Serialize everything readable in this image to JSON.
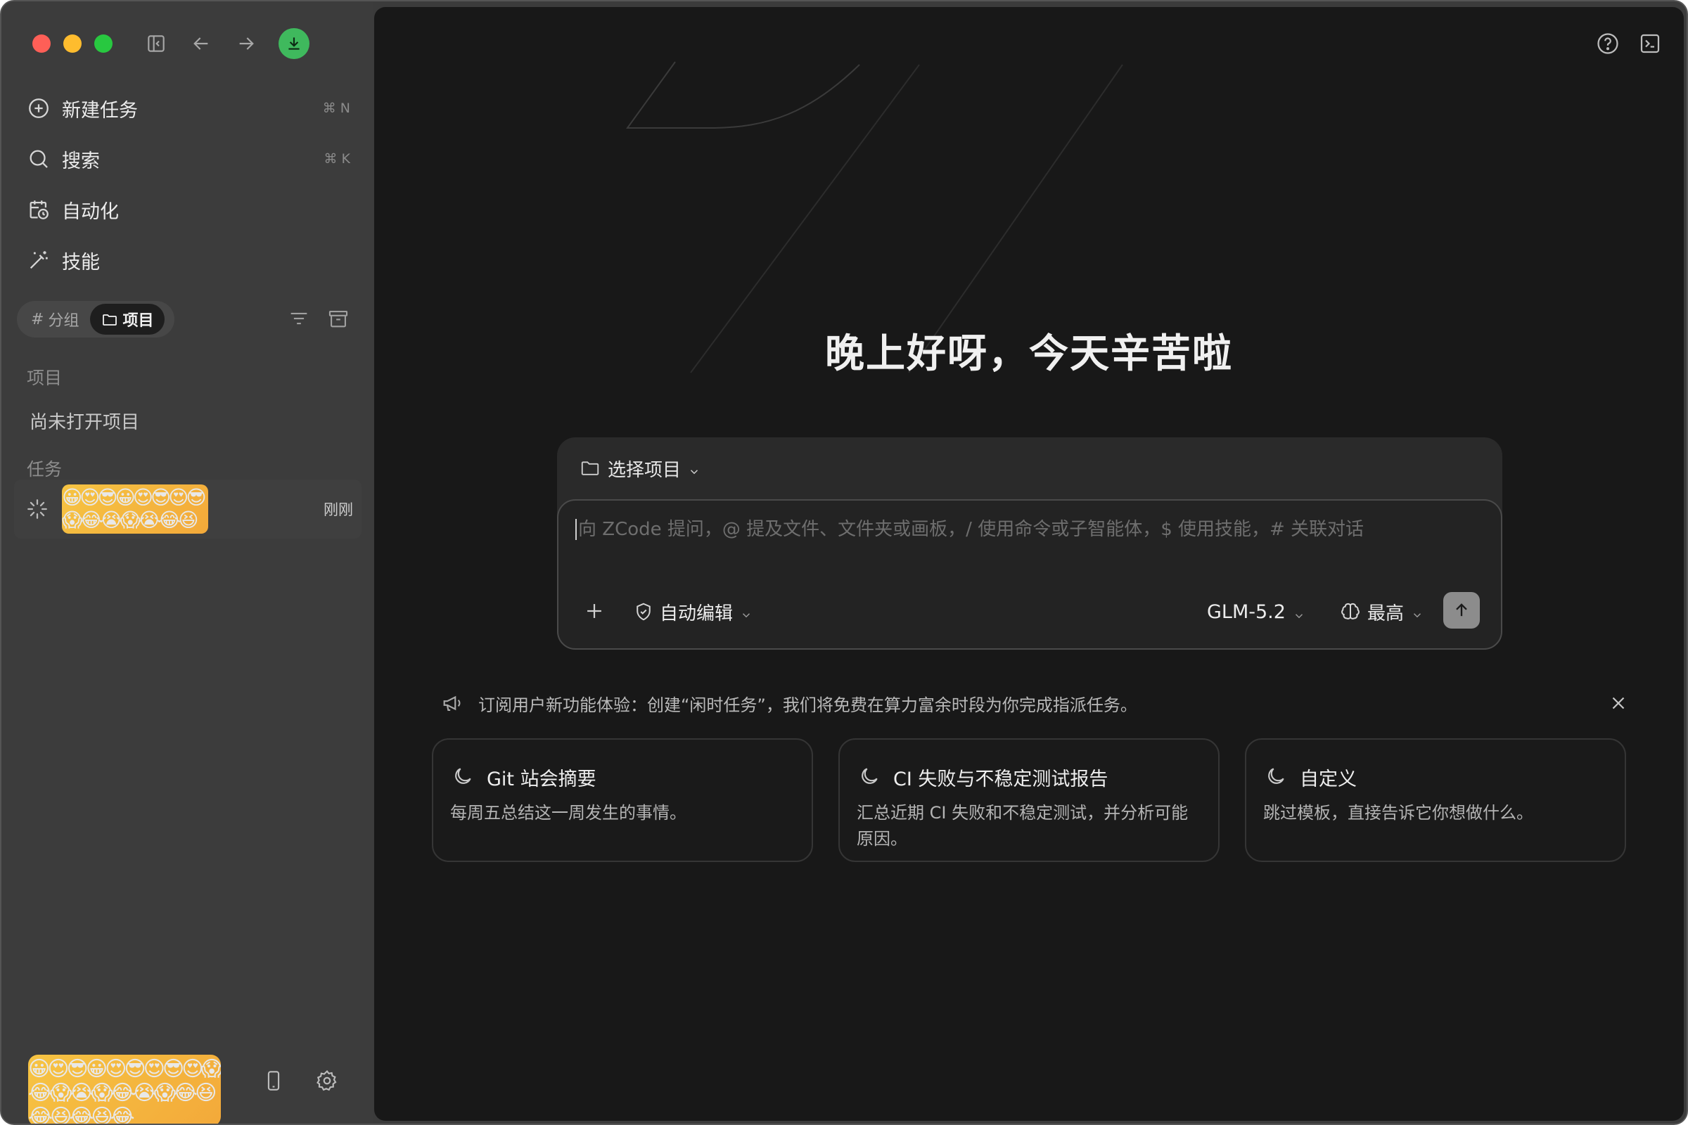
{
  "sidebar": {
    "shortcuts": {
      "new_task": "⌘ N",
      "search": "⌘ K"
    },
    "nav": {
      "new_task": "新建任务",
      "search": "搜索",
      "automation": "自动化",
      "skills": "技能"
    },
    "segments": {
      "groups": "分组",
      "projects": "项目",
      "groups_prefix": "#"
    },
    "sections": {
      "projects": "项目",
      "tasks": "任务"
    },
    "empty_projects": "尚未打开项目",
    "task": {
      "thumbnail_emojis": "😀😍😎😀😍😎😍😎😱😂😭😱😭😂😆",
      "time": "刚刚"
    },
    "avatar_emojis": "😀😍😎😀😍😎😍😎😍😱😂😱😭😱😂😭😱😂😆😂😆😂😆😂"
  },
  "main": {
    "greeting": "晚上好呀，今天辛苦啦",
    "composer": {
      "project_picker": "选择项目",
      "placeholder": "向 ZCode 提问，@ 提及文件、文件夹或画板，/ 使用命令或子智能体，$ 使用技能，# 关联对话",
      "mode": "自动编辑",
      "model": "GLM-5.2",
      "effort": "最高"
    },
    "notice": "订阅用户新功能体验：创建“闲时任务”，我们将免费在算力富余时段为你完成指派任务。",
    "cards": [
      {
        "title": "Git 站会摘要",
        "desc": "每周五总结这一周发生的事情。"
      },
      {
        "title": "CI 失败与不稳定测试报告",
        "desc": "汇总近期 CI 失败和不稳定测试，并分析可能原因。"
      },
      {
        "title": "自定义",
        "desc": "跳过模板，直接告诉它你想做什么。"
      }
    ]
  },
  "colors": {
    "sidebar_bg": "#3c3c3c",
    "main_bg": "#181818",
    "download_accent": "#3fb95d",
    "traffic_red": "#fe5f57",
    "traffic_yellow": "#febc2e",
    "traffic_green": "#28c840"
  },
  "icons": [
    "sidebar-toggle-icon",
    "back-arrow-icon",
    "forward-arrow-icon",
    "download-icon",
    "plus-circle-icon",
    "search-icon",
    "calendar-clock-icon",
    "magic-wand-icon",
    "hash-icon",
    "folder-icon",
    "filter-icon",
    "archive-icon",
    "spinner-icon",
    "phone-icon",
    "gear-icon",
    "help-icon",
    "terminal-icon",
    "shield-icon",
    "brain-icon",
    "arrow-up-icon",
    "megaphone-icon",
    "close-icon",
    "moon-icon",
    "chevron-down-icon",
    "plus-icon"
  ]
}
